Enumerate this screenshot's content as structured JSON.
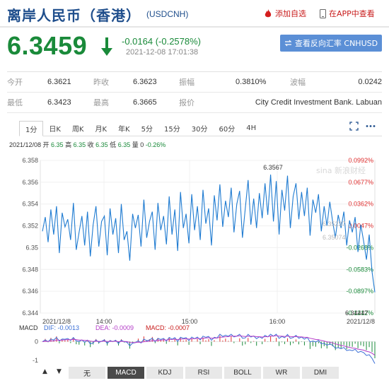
{
  "header": {
    "title": "离岸人民币（香港）",
    "code": "(USDCNH)",
    "fav_label": "添加自选",
    "app_label": "在APP中查看"
  },
  "quote": {
    "price": "6.3459",
    "change": "-0.0164 (-0.2578%)",
    "timestamp": "2021-12-08 17:01:38",
    "reverse_button": "查看反向汇率 CNHUSD"
  },
  "stats": {
    "open_label": "今开",
    "open": "6.3621",
    "prev_label": "昨收",
    "prev": "6.3623",
    "amp_label": "振幅",
    "amp": "0.3810%",
    "wave_label": "波幅",
    "wave": "0.0242",
    "low_label": "最低",
    "low": "6.3423",
    "high_label": "最高",
    "high": "6.3665",
    "quoter_label": "报价",
    "quoter": "City Credit Investment Bank. Labuan"
  },
  "tabs": [
    "1分",
    "日K",
    "周K",
    "月K",
    "年K",
    "5分",
    "15分",
    "30分",
    "60分",
    "4H"
  ],
  "active_tab": "1分",
  "info_line": {
    "prefix": "2021/12/08 开 ",
    "open": "6.35",
    "high_label": " 高 ",
    "high": "6.35",
    "low_label": " 收 ",
    "close": "6.35",
    "close_label": " 低 ",
    "low": "6.35",
    "vol_label": " 量 0 ",
    "pct": "-0.26%"
  },
  "colors": {
    "up": "#e03030",
    "down": "#1a8a3a",
    "line": "#1f7bd1",
    "accent": "#1f4e8c"
  },
  "chart_data": {
    "type": "line",
    "y_ticks": [
      "6.358",
      "6.356",
      "6.354",
      "6.352",
      "6.35",
      "6.348",
      "6.346",
      "6.344"
    ],
    "pct_ticks": [
      "0.0992%",
      "0.0677%",
      "0.0362%",
      "0.0047%",
      "-0.0268%",
      "-0.0583%",
      "-0.0897%",
      "-0.1212%"
    ],
    "x_ticks": [
      "2021/12/8",
      "14:00",
      "15:00",
      "16:00",
      "2021/12/8"
    ],
    "ylim": [
      6.344,
      6.358
    ],
    "peak_label": "6.3567",
    "overlay_labels": [
      "6.35237",
      "6.35074"
    ],
    "bottom_tick": "6.34447",
    "values": [
      6.3515,
      6.3528,
      6.3505,
      6.3535,
      6.3512,
      6.3538,
      6.3495,
      6.3532,
      6.3519,
      6.3526,
      6.3507,
      6.3541,
      6.3498,
      6.3514,
      6.3529,
      6.3502,
      6.3533,
      6.3492,
      6.3521,
      6.3538,
      6.3501,
      6.3524,
      6.3529,
      6.3493,
      6.3536,
      6.3512,
      6.3527,
      6.3495,
      6.354,
      6.3507,
      6.3515,
      6.3488,
      6.3531,
      6.3518,
      6.353,
      6.3501,
      6.3544,
      6.3509,
      6.3524,
      6.3533,
      6.3498,
      6.3541,
      6.3516,
      6.3529,
      6.3503,
      6.3547,
      6.3512,
      6.3535,
      6.3497,
      6.3551,
      6.3518,
      6.3531,
      6.3504,
      6.3549,
      6.3516,
      6.3538,
      6.3507,
      6.3553,
      6.3522,
      6.3536,
      6.3502,
      6.3548,
      6.3525,
      6.3558,
      6.3519,
      6.3543,
      6.3528,
      6.3555,
      6.3514,
      6.354,
      6.3552,
      6.3509,
      6.3536,
      6.3562,
      6.3521,
      6.3545,
      6.3518,
      6.355,
      6.3527,
      6.3559,
      6.353,
      6.3567,
      6.3524,
      6.3561,
      6.3512,
      6.3553,
      6.3534,
      6.3566,
      6.3518,
      6.3547,
      6.3559,
      6.3526,
      6.3551,
      6.3529,
      6.3555,
      6.3511,
      6.3544,
      6.3532,
      6.3549,
      6.3515,
      6.3538,
      6.352,
      6.3542,
      6.3524,
      6.3509,
      6.353,
      6.3518,
      6.3533,
      6.3502,
      6.3525,
      6.3514,
      6.3528,
      6.3496,
      6.3521,
      6.3506,
      6.3489,
      6.3512,
      6.3478,
      6.3459
    ],
    "macd_label": "MACD",
    "dif_label": "DIF: -0.0013",
    "dea_label": "DEA: -0.0009",
    "macd_value_label": "MACD: -0.0007",
    "macd_ylim": [
      -1.2,
      0.4
    ],
    "macd_ticks": [
      "0",
      "-1"
    ]
  },
  "bottom_tabs": [
    "无",
    "MACD",
    "KDJ",
    "RSI",
    "BOLL",
    "WR",
    "DMI"
  ],
  "active_bottom_tab": "MACD"
}
